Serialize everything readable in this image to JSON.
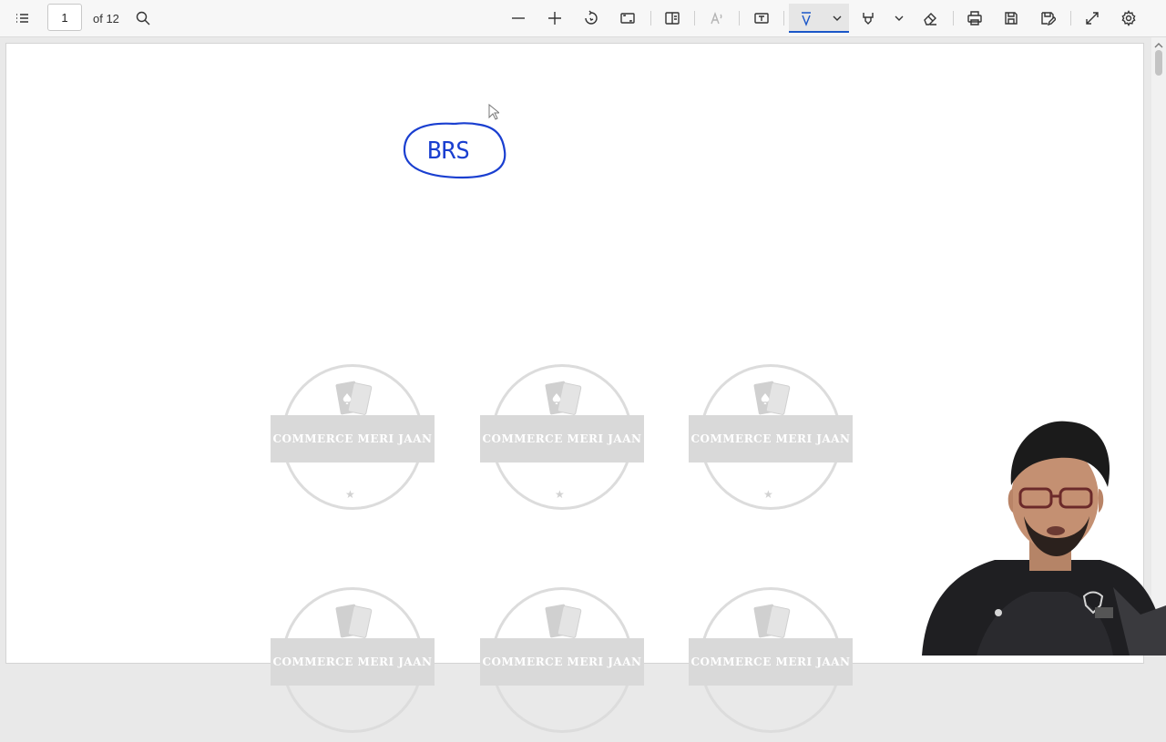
{
  "toolbar": {
    "page_number": "1",
    "page_count": "of 12",
    "icons": [
      "contents-icon",
      "search-icon",
      "zoom-out-icon",
      "zoom-in-icon",
      "rotate-icon",
      "fit-page-icon",
      "page-view-icon",
      "read-aloud-icon",
      "text-box-icon",
      "draw-icon",
      "chevron-down-icon",
      "highlight-icon",
      "chevron-down-icon",
      "eraser-icon",
      "print-icon",
      "save-icon",
      "save-as-icon",
      "fullscreen-icon",
      "settings-icon"
    ]
  },
  "annotation": {
    "text": "BRS",
    "color": "#1a3fd0"
  },
  "watermark": {
    "text": "COMMERCE MERI JAAN",
    "color": "#d9d9d9"
  },
  "colors": {
    "accent": "#1a56c8"
  }
}
